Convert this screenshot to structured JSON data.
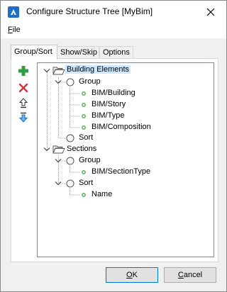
{
  "window": {
    "title": "Configure Structure Tree [MyBim]"
  },
  "menu": {
    "file_prefix": "F",
    "file_rest": "ile"
  },
  "tabs": [
    {
      "label": "Group/Sort",
      "active": true
    },
    {
      "label": "Show/Skip",
      "active": false
    },
    {
      "label": "Options",
      "active": false
    }
  ],
  "toolbar": {
    "icons": [
      "add-icon",
      "delete-icon",
      "move-up-icon",
      "move-down-icon"
    ],
    "add_color": "#2ea043",
    "delete_color": "#d13438",
    "arrow_color": "#1f6fbf"
  },
  "tree": {
    "nodes": [
      {
        "label": "Building Elements",
        "type": "folder",
        "selected": true
      },
      {
        "label": "Group",
        "type": "radio"
      },
      {
        "label": "BIM/Building",
        "type": "leaf"
      },
      {
        "label": "BIM/Story",
        "type": "leaf"
      },
      {
        "label": "BIM/Type",
        "type": "leaf"
      },
      {
        "label": "BIM/Composition",
        "type": "leaf"
      },
      {
        "label": "Sort",
        "type": "radio"
      },
      {
        "label": "Sections",
        "type": "folder",
        "selected": false
      },
      {
        "label": "Group",
        "type": "radio"
      },
      {
        "label": "BIM/SectionType",
        "type": "leaf"
      },
      {
        "label": "Sort",
        "type": "radio"
      },
      {
        "label": "Name",
        "type": "leaf"
      }
    ],
    "leaf_dot_color": "#3cb043",
    "selection_color": "#cce8ff"
  },
  "buttons": {
    "ok_prefix": "O",
    "ok_rest": "K",
    "cancel_prefix": "C",
    "cancel_rest": "ancel"
  }
}
